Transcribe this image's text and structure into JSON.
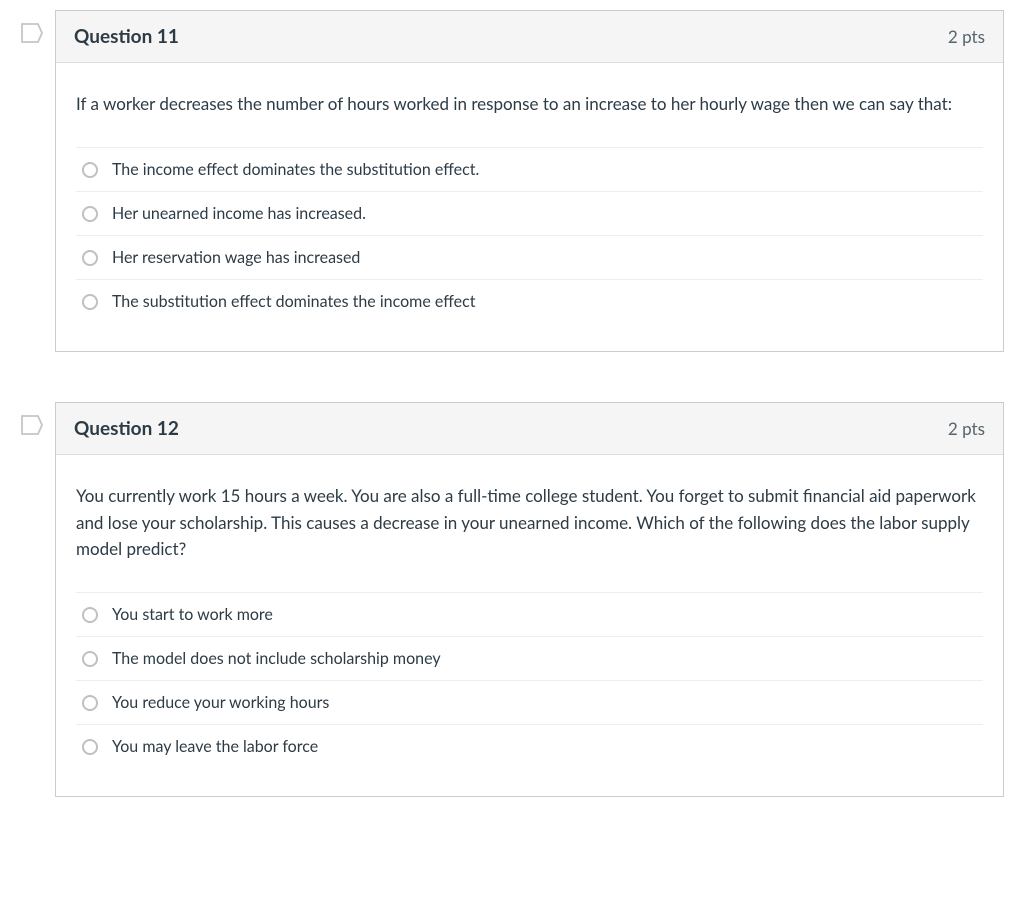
{
  "questions": [
    {
      "title": "Question 11",
      "points": "2 pts",
      "prompt": "If a worker decreases the number of hours worked in response to an increase to her hourly wage then we can say that:",
      "answers": [
        "The income effect dominates the substitution effect.",
        "Her unearned income has increased.",
        "Her reservation wage has increased",
        "The substitution effect dominates the income effect"
      ]
    },
    {
      "title": "Question 12",
      "points": "2 pts",
      "prompt": "You currently work 15 hours a week. You are also a full-time college student. You forget to submit financial aid paperwork and lose your scholarship. This causes a decrease in your unearned income. Which of the following does the labor supply model predict?",
      "answers": [
        "You start to work more",
        "The model does not include scholarship money",
        "You reduce your working hours",
        "You may leave the labor force"
      ]
    }
  ]
}
